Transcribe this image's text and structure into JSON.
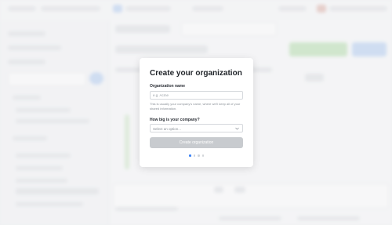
{
  "modal": {
    "title": "Create your organization",
    "org_name_label": "Organization name",
    "org_name_placeholder": "e.g. Acme",
    "org_name_value": "",
    "org_name_help": "This is usually your company's name, where we'll keep all of your shared information.",
    "company_size_label": "How big is your company?",
    "company_size_value": "Select an option...",
    "submit_label": "Create organization",
    "steps_total": 4,
    "steps_current": 1
  },
  "colors": {
    "accent": "#3b82f6",
    "disabled_button": "#c8cbcf"
  },
  "icons": {
    "select": "chevron-down-icon"
  }
}
